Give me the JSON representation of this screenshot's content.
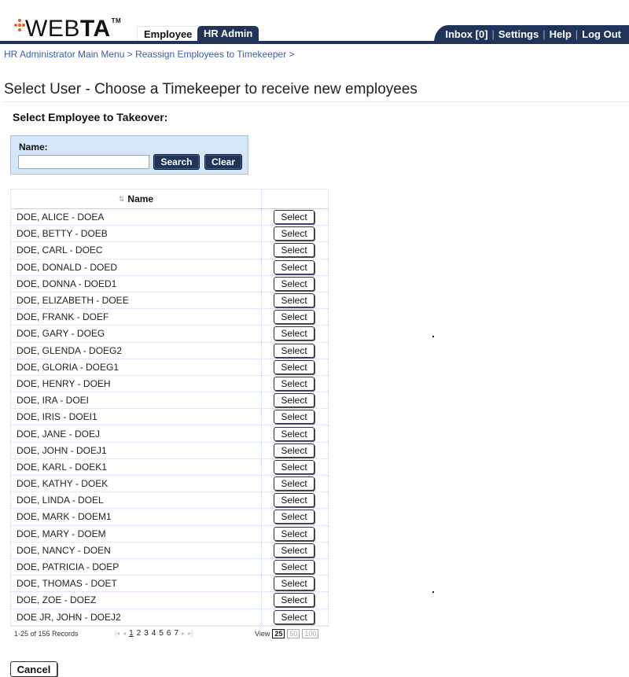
{
  "header": {
    "logo_text_thin": "WEB",
    "logo_text_bold": "TA",
    "logo_tm": "TM",
    "tabs": [
      {
        "label": "Employee",
        "active": false
      },
      {
        "label": "HR Admin",
        "active": true
      }
    ],
    "utility_links": [
      {
        "label": "Inbox [0]"
      },
      {
        "label": "Settings"
      },
      {
        "label": "Help"
      },
      {
        "label": "Log Out"
      }
    ],
    "utility_separator": "|"
  },
  "breadcrumb": {
    "items": [
      {
        "label": "HR Administrator Main Menu"
      },
      {
        "label": "Reassign Employees to Timekeeper"
      }
    ],
    "separator": ">"
  },
  "page": {
    "title": "Select User - Choose a Timekeeper to receive new employees",
    "section_title": "Select Employee to Takeover:"
  },
  "search": {
    "label": "Name:",
    "value": "",
    "placeholder": "",
    "search_label": "Search",
    "clear_label": "Clear"
  },
  "table": {
    "columns": [
      {
        "label": "Name",
        "sortable": true
      },
      {
        "label": ""
      }
    ],
    "select_label": "Select",
    "rows": [
      {
        "name": "DOE, ALICE - DOEA"
      },
      {
        "name": "DOE, BETTY - DOEB"
      },
      {
        "name": "DOE, CARL - DOEC"
      },
      {
        "name": "DOE, DONALD - DOED"
      },
      {
        "name": "DOE, DONNA - DOED1"
      },
      {
        "name": "DOE, ELIZABETH - DOEE"
      },
      {
        "name": "DOE, FRANK - DOEF"
      },
      {
        "name": "DOE, GARY - DOEG"
      },
      {
        "name": "DOE, GLENDA - DOEG2"
      },
      {
        "name": "DOE, GLORIA - DOEG1"
      },
      {
        "name": "DOE, HENRY - DOEH"
      },
      {
        "name": "DOE, IRA - DOEI"
      },
      {
        "name": "DOE, IRIS - DOEI1"
      },
      {
        "name": "DOE, JANE - DOEJ"
      },
      {
        "name": "DOE, JOHN - DOEJ1"
      },
      {
        "name": "DOE, KARL - DOEK1"
      },
      {
        "name": "DOE, KATHY - DOEK"
      },
      {
        "name": "DOE, LINDA - DOEL"
      },
      {
        "name": "DOE, MARK - DOEM1"
      },
      {
        "name": "DOE, MARY - DOEM"
      },
      {
        "name": "DOE, NANCY - DOEN"
      },
      {
        "name": "DOE, PATRICIA - DOEP"
      },
      {
        "name": "DOE, THOMAS - DOET"
      },
      {
        "name": "DOE, ZOE - DOEZ"
      },
      {
        "name": "DOE JR, JOHN - DOEJ2"
      }
    ]
  },
  "footer": {
    "records_text": "1-25 of 155 Records",
    "pager": {
      "first_icon": "first-page-icon",
      "prev_icon": "prev-page-icon",
      "pages": [
        "1",
        "2",
        "3",
        "4",
        "5",
        "6",
        "7"
      ],
      "current_page": "1",
      "next_icon": "next-page-icon",
      "last_icon": "last-page-icon"
    },
    "view_label": "View",
    "view_options": [
      "25",
      "50",
      "100"
    ],
    "view_selected": "25"
  },
  "actions": {
    "cancel_label": "Cancel"
  }
}
